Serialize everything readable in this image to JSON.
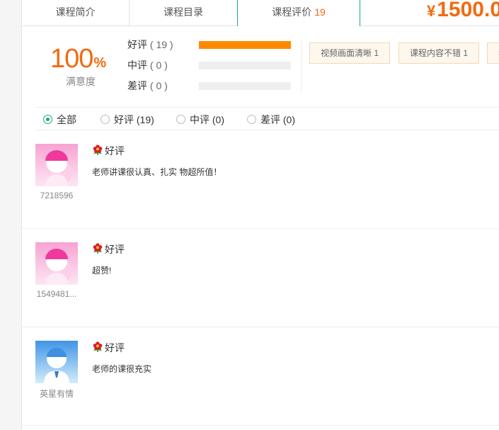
{
  "tabs": [
    {
      "label": "课程简介"
    },
    {
      "label": "课程目录"
    },
    {
      "label": "课程评价",
      "count": "19"
    }
  ],
  "price": {
    "currency": "¥",
    "amount": "1500.0"
  },
  "summary": {
    "percent": "100",
    "percent_sign": "%",
    "satisfaction_label": "满意度",
    "ratings": [
      {
        "label": "好评",
        "count": "( 19 )",
        "fraction": 1.0
      },
      {
        "label": "中评",
        "count": "( 0 )",
        "fraction": 0.0
      },
      {
        "label": "差评",
        "count": "( 0 )",
        "fraction": 0.0
      }
    ],
    "tags": [
      "视频画面清晰 1",
      "课程内容不错 1",
      "老"
    ]
  },
  "filter": {
    "options": [
      "全部",
      "好评 (19)",
      "中评 (0)",
      "差评 (0)"
    ],
    "selected": "全部"
  },
  "reviews": [
    {
      "username": "7218596",
      "rating": "好评",
      "content": "老师讲课很认真、扎实 物超所值！",
      "avatar": "pink-avatar"
    },
    {
      "username": "1549481...",
      "rating": "好评",
      "content": "超赞!",
      "avatar": "pink-avatar"
    },
    {
      "username": "英星有情",
      "rating": "好评",
      "content": "老师的课很充实",
      "avatar": "blue-avatar"
    }
  ],
  "colors": {
    "accent": "#f26a10",
    "green": "#1aa87e",
    "bar": "#ff8a00"
  }
}
